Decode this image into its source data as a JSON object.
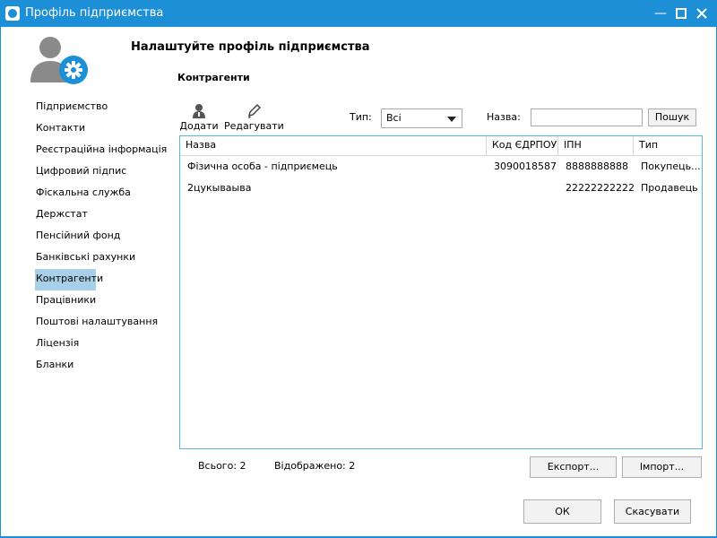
{
  "window": {
    "title": "Профіль підприємства",
    "accent_color": "#1c8fd6"
  },
  "header": {
    "title": "Налаштуйте профіль підприємства",
    "section": "Контрагенти"
  },
  "sidebar": {
    "items": [
      {
        "label": "Підприємство"
      },
      {
        "label": "Контакти"
      },
      {
        "label": "Реєстраційна інформація"
      },
      {
        "label": "Цифровий підпис"
      },
      {
        "label": "Фіскальна служба"
      },
      {
        "label": "Держстат"
      },
      {
        "label": "Пенсійний фонд"
      },
      {
        "label": "Банківські рахунки"
      },
      {
        "label": "Контрагенти"
      },
      {
        "label": "Працівники"
      },
      {
        "label": "Поштові налаштування"
      },
      {
        "label": "Ліцензія"
      },
      {
        "label": "Бланки"
      }
    ],
    "active_index": 8,
    "active_color": "#a8cfe8"
  },
  "toolbar": {
    "add_label": "Додати",
    "edit_label": "Редагувати"
  },
  "filters": {
    "type_label": "Тип:",
    "type_value": "Всі",
    "name_label": "Назва:",
    "name_value": "",
    "search_label": "Пошук"
  },
  "table": {
    "columns": [
      "Назва",
      "Код ЄДРПОУ",
      "ІПН",
      "Тип"
    ],
    "rows": [
      [
        "Фізична особа - підприємець",
        "3090018587",
        "8888888888",
        "Покупець..."
      ],
      [
        "2цукываыва",
        "",
        "222222222222",
        "Продавець"
      ]
    ]
  },
  "footer": {
    "total": "Всього: 2",
    "shown": "Відображено: 2",
    "export_label": "Експорт...",
    "import_label": "Імпорт...",
    "ok_label": "ОК",
    "cancel_label": "Скасувати"
  }
}
